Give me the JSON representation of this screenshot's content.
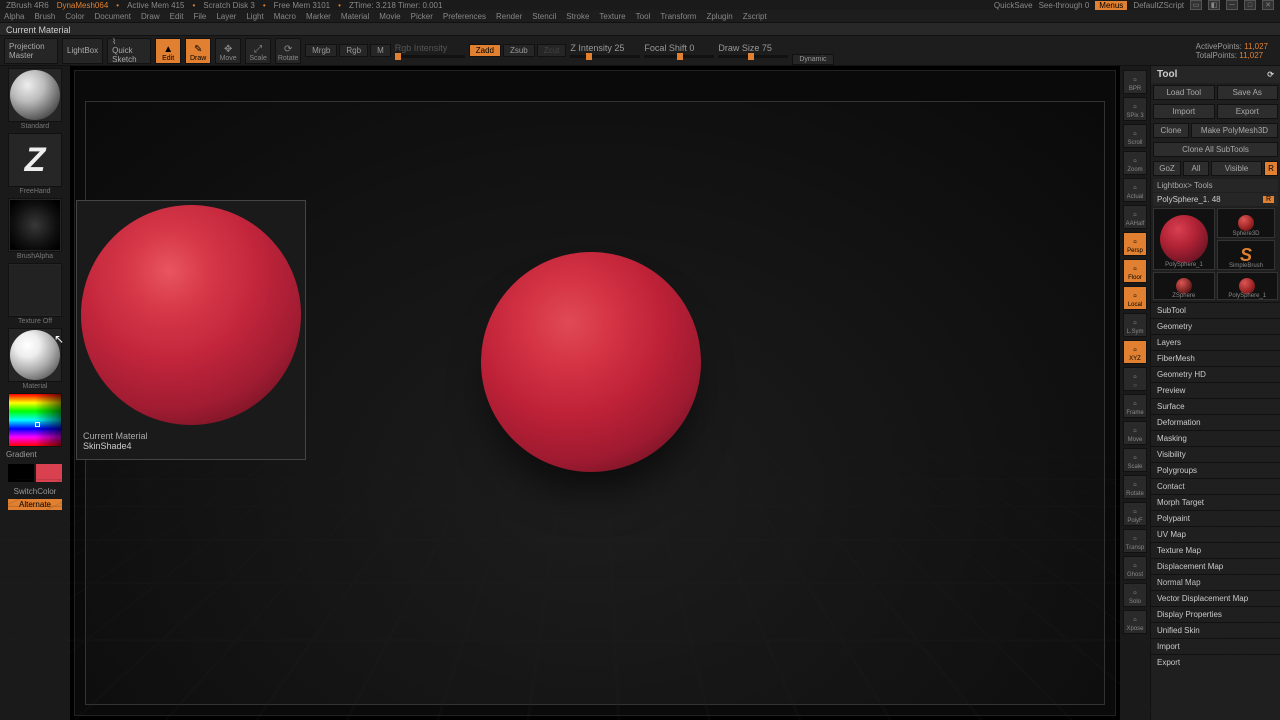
{
  "topinfo": {
    "app": "ZBrush 4R6",
    "doc": "DynaMesh064",
    "mem": "Active Mem 415",
    "scratch": "Scratch Disk 3",
    "free": "Free Mem 3101",
    "ztime": "ZTime: 3.218 Timer: 0.001",
    "quicksave": "QuickSave",
    "seethrough": "See-through  0",
    "menus": "Menus",
    "script": "DefaultZScript"
  },
  "menubar": [
    "Alpha",
    "Brush",
    "Color",
    "Document",
    "Draw",
    "Edit",
    "File",
    "Layer",
    "Light",
    "Macro",
    "Marker",
    "Material",
    "Movie",
    "Picker",
    "Preferences",
    "Render",
    "Stencil",
    "Stroke",
    "Texture",
    "Tool",
    "Transform",
    "Zplugin",
    "Zscript"
  ],
  "statusline": "Current Material",
  "toolbar": {
    "projection": "Projection Master",
    "lightbox": "LightBox",
    "quicksketch": "Quick Sketch",
    "edit": "Edit",
    "draw": "Draw",
    "move": "Move",
    "scale": "Scale",
    "rotate": "Rotate",
    "mrgb": "Mrgb",
    "rgb": "Rgb",
    "m": "M",
    "rgbint_lbl": "Rgb Intensity",
    "zadd": "Zadd",
    "zsub": "Zsub",
    "zcut": "Zcut",
    "zint_lbl": "Z Intensity 25",
    "focal_lbl": "Focal Shift 0",
    "draw_lbl": "Draw Size 75",
    "dynamic": "Dynamic",
    "active_pts_lbl": "ActivePoints:",
    "active_pts": "11,027",
    "total_pts_lbl": "TotalPoints:",
    "total_pts": "11,027"
  },
  "left": {
    "brush": "Standard",
    "stroke": "FreeHand",
    "alpha": "BrushAlpha",
    "texture": "Texture Off",
    "material": "Material",
    "gradient": "Gradient",
    "switch": "SwitchColor",
    "alternate": "Alternate"
  },
  "popup": {
    "title": "Current Material",
    "name": "SkinShade4"
  },
  "rightshelf": [
    "BPR",
    "SPix 3",
    "Scroll",
    "Zoom",
    "Actual",
    "AAHalf",
    "Persp",
    "Floor",
    "Local",
    "L.Sym",
    "XYZ",
    "○",
    "Frame",
    "Move",
    "Scale",
    "Rotate",
    "PolyF",
    "Transp",
    "Ghost",
    "Solo",
    "Xpose"
  ],
  "rightshelf_on": [
    6,
    7,
    8,
    10
  ],
  "tool": {
    "title": "Tool",
    "load": "Load Tool",
    "saveas": "Save As",
    "import": "Import",
    "export": "Export",
    "clone": "Clone",
    "makepoly": "Make PolyMesh3D",
    "cloneall": "Clone All SubTools",
    "goz": "GoZ",
    "all": "All",
    "visible": "Visible",
    "r": "R",
    "lightbox": "Lightbox> Tools",
    "toolname": "PolySphere_1. 48",
    "thumb_main": "PolySphere_1",
    "thumb1": "Sphere3D",
    "thumb2": "SimpleBrush",
    "thumb3": "ZSphere",
    "thumb4": "PolySphere_1",
    "sections": [
      "SubTool",
      "Geometry",
      "Layers",
      "FiberMesh",
      "Geometry HD",
      "Preview",
      "Surface",
      "Deformation",
      "Masking",
      "Visibility",
      "Polygroups",
      "Contact",
      "Morph Target",
      "Polypaint",
      "UV Map",
      "Texture Map",
      "Displacement Map",
      "Normal Map",
      "Vector Displacement Map",
      "Display Properties",
      "Unified Skin",
      "Import",
      "Export"
    ]
  }
}
